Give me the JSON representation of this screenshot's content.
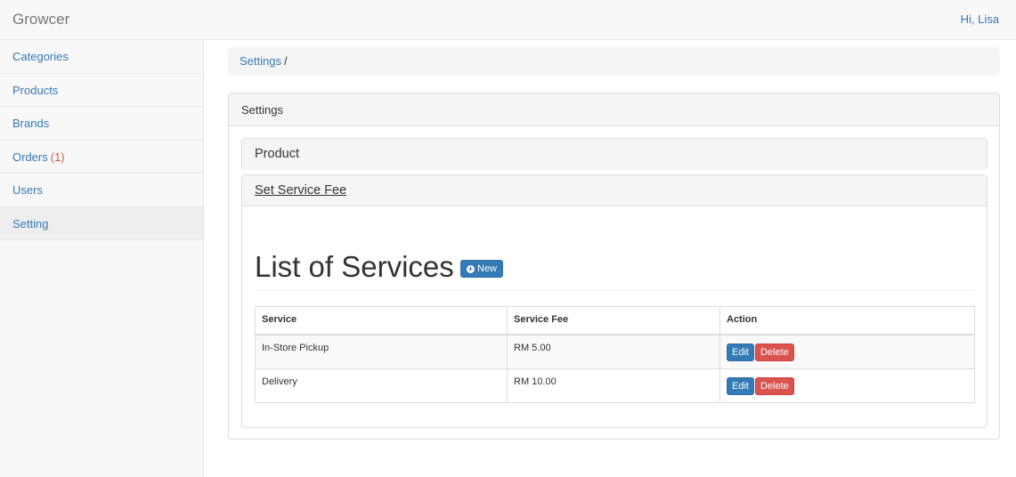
{
  "navbar": {
    "brand": "Growcer",
    "user_greeting": "Hi, Lisa"
  },
  "sidebar": {
    "items": [
      {
        "label": "Categories",
        "badge": ""
      },
      {
        "label": "Products",
        "badge": ""
      },
      {
        "label": "Brands",
        "badge": ""
      },
      {
        "label": "Orders",
        "badge": "(1)"
      },
      {
        "label": "Users",
        "badge": ""
      },
      {
        "label": "Setting",
        "badge": ""
      }
    ],
    "active_item": "Setting"
  },
  "breadcrumb": {
    "link": "Settings",
    "separator": "/"
  },
  "settings_panel": {
    "title": "Settings",
    "accordion": [
      {
        "label": "Product"
      },
      {
        "label": "Set Service Fee"
      }
    ]
  },
  "services": {
    "heading": "List of Services",
    "new_button": "New",
    "columns": [
      "Service",
      "Service Fee",
      "Action"
    ],
    "rows": [
      {
        "service": "In-Store Pickup",
        "fee": "RM 5.00",
        "edit": "Edit",
        "delete": "Delete"
      },
      {
        "service": "Delivery",
        "fee": "RM 10.00",
        "edit": "Edit",
        "delete": "Delete"
      }
    ]
  },
  "colors": {
    "link": "#337ab7",
    "danger": "#d9534f",
    "panel_bg": "#f5f5f5"
  }
}
